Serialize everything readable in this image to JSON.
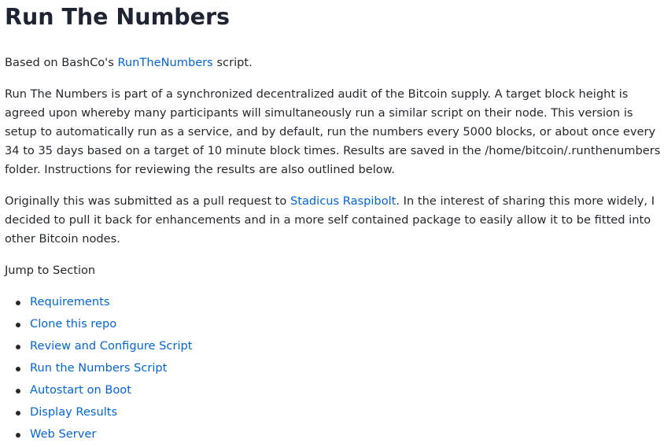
{
  "title": "Run The Numbers",
  "intro": {
    "prefix": "Based on BashCo's ",
    "link": "RunTheNumbers",
    "suffix": " script."
  },
  "description": "Run The Numbers is part of a synchronized decentralized audit of the Bitcoin supply. A target block height is agreed upon whereby many participants will simultaneously run a similar script on their node. This version is setup to automatically run as a service, and by default, run the numbers every 5000 blocks, or about once every 34 to 35 days based on a target of 10 minute block times. Results are saved in the /home/bitcoin/.runthenumbers folder. Instructions for reviewing the results are also outlined below.",
  "origin": {
    "prefix": "Originally this was submitted as a pull request to ",
    "link": "Stadicus Raspibolt",
    "suffix": ". In the interest of sharing this more widely, I decided to pull it back for enhancements and in a more self contained package to easily allow it to be fitted into other Bitcoin nodes."
  },
  "jump_label": "Jump to Section",
  "sections": [
    "Requirements",
    "Clone this repo",
    "Review and Configure Script",
    "Run the Numbers Script",
    "Autostart on Boot",
    "Display Results",
    "Web Server"
  ],
  "colors": {
    "link": "#0366d6",
    "text": "#24292e",
    "heading": "#1f2433"
  }
}
